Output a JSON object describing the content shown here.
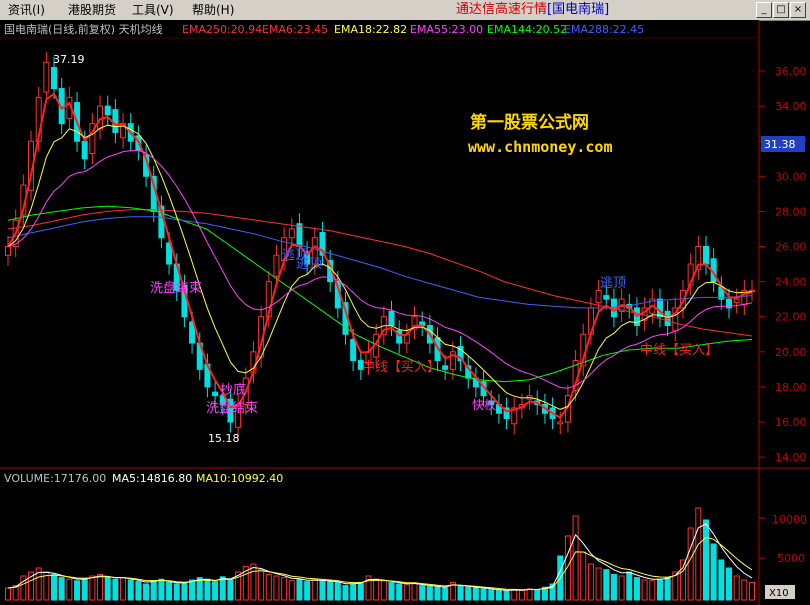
{
  "menu": {
    "items": [
      "资讯(I)",
      "港股期货",
      "工具(V)",
      "帮助(H)"
    ]
  },
  "window": {
    "title": "通达信高速行情",
    "stock": "[国电南瑞]",
    "buttons": [
      "_",
      "□",
      "×"
    ]
  },
  "header": {
    "caption": "国电南瑞(日线,前复权) 天机均线",
    "indicators": [
      {
        "text": "EMA250:20.94",
        "color": "#ff3030"
      },
      {
        "text": "EMA6:23.45",
        "color": "#ff3030"
      },
      {
        "text": "EMA18:22.82",
        "color": "#ffff40"
      },
      {
        "text": "EMA55:23.00",
        "color": "#ff40ff"
      },
      {
        "text": "EMA144:20.52",
        "color": "#00ff00"
      },
      {
        "text": "EMA288:22.45",
        "color": "#4060ff"
      }
    ]
  },
  "watermark": {
    "line1": "第一股票公式网",
    "line2": "www.chnmoney.com"
  },
  "price_axis": {
    "ticks": [
      "36.00",
      "34.00",
      "32.00",
      "30.00",
      "28.00",
      "26.00",
      "24.00",
      "22.00",
      "20.00",
      "18.00",
      "16.00",
      "14.00"
    ],
    "current": "31.38"
  },
  "annotations": {
    "high": "37.19",
    "low": "15.18",
    "wash1": "洗盘结束",
    "wash2": "洗盘结束",
    "bottom": "抄底",
    "top1": "逃顶",
    "top2": "逃顶",
    "top3": "逃顶",
    "mid_buy1": "中线【买入】",
    "mid_buy2": "中线【买入】",
    "fast": "快枚"
  },
  "volume": {
    "label": "VOLUME:17176.00",
    "ma5": "MA5:14816.80",
    "ma10": "MA10:10992.40",
    "ticks": [
      "10000",
      "5000"
    ],
    "unit": "X10"
  },
  "chart_data": {
    "type": "line",
    "note_series": "candlestick daily prices, approximate closes",
    "ylim": [
      13.2,
      37.2
    ],
    "close": [
      26.0,
      27.5,
      29.5,
      32.0,
      34.5,
      36.5,
      35.0,
      33.0,
      34.5,
      32.0,
      31.0,
      33.0,
      34.0,
      33.5,
      32.5,
      33.0,
      32.0,
      31.5,
      30.0,
      28.0,
      26.5,
      25.0,
      23.5,
      22.0,
      20.5,
      19.0,
      18.0,
      17.5,
      17.0,
      16.0,
      17.0,
      18.5,
      20.0,
      22.0,
      24.0,
      25.5,
      26.5,
      27.0,
      26.0,
      25.0,
      26.5,
      25.5,
      24.0,
      22.5,
      21.0,
      19.5,
      19.0,
      20.0,
      21.0,
      22.0,
      21.5,
      20.5,
      21.0,
      22.0,
      21.5,
      20.5,
      19.5,
      19.0,
      20.0,
      19.5,
      18.5,
      18.0,
      17.5,
      17.0,
      16.5,
      16.2,
      16.8,
      17.0,
      17.5,
      17.0,
      16.5,
      16.2,
      16.0,
      17.5,
      19.5,
      21.0,
      22.5,
      23.5,
      23.0,
      22.0,
      23.0,
      22.5,
      21.5,
      22.5,
      23.0,
      22.0,
      21.5,
      22.5,
      23.5,
      25.0,
      26.0,
      25.0,
      24.0,
      23.0,
      22.5,
      23.0,
      23.5,
      23.5
    ],
    "volume": [
      1500,
      1800,
      3000,
      3500,
      4000,
      3500,
      3200,
      2800,
      2600,
      2400,
      2600,
      3000,
      3200,
      2900,
      2600,
      2800,
      2500,
      2300,
      2000,
      2400,
      2600,
      2200,
      2000,
      2100,
      2500,
      2800,
      2600,
      2300,
      2900,
      2600,
      3500,
      4200,
      4500,
      3800,
      3200,
      3000,
      2800,
      2400,
      2600,
      2300,
      2500,
      2400,
      2300,
      2200,
      1800,
      2000,
      2200,
      3000,
      2600,
      2400,
      2200,
      2000,
      1900,
      2100,
      1800,
      1700,
      1600,
      1500,
      2200,
      1800,
      1600,
      1500,
      1400,
      1300,
      1200,
      1100,
      1300,
      1200,
      1400,
      1300,
      1600,
      2000,
      5500,
      8000,
      10500,
      6000,
      4500,
      4000,
      3800,
      3200,
      3000,
      3500,
      2800,
      2500,
      2400,
      2600,
      2800,
      3500,
      5000,
      9000,
      11500,
      10000,
      7000,
      5000,
      4000,
      3000,
      2500,
      2200
    ],
    "ma": [
      {
        "name": "EMA250",
        "color": "#ff3030",
        "values": [
          27.0,
          27.2,
          27.5,
          27.8,
          28.0,
          28.1,
          28.1,
          28.0,
          27.9,
          27.7,
          27.5,
          27.3,
          27.1,
          26.9,
          26.6,
          26.3,
          26.0,
          25.6,
          25.1,
          24.6,
          24.0,
          23.6,
          23.2,
          22.9,
          22.6,
          22.3,
          22.0,
          21.6,
          21.3,
          21.1,
          20.9
        ]
      },
      {
        "name": "EMA144",
        "color": "#00ff00",
        "values": [
          27.5,
          27.8,
          28.0,
          28.2,
          28.3,
          28.2,
          28.0,
          27.5,
          27.0,
          26.0,
          25.0,
          24.0,
          23.0,
          22.0,
          21.0,
          20.3,
          19.7,
          19.1,
          18.7,
          18.4,
          18.3,
          18.4,
          18.8,
          19.3,
          19.8,
          20.1,
          20.2,
          20.2,
          20.4,
          20.6,
          20.7
        ]
      },
      {
        "name": "EMA288",
        "color": "#4060ff",
        "values": [
          26.5,
          26.8,
          27.1,
          27.4,
          27.6,
          27.7,
          27.7,
          27.5,
          27.3,
          27.0,
          26.7,
          26.3,
          26.0,
          25.6,
          25.2,
          24.8,
          24.3,
          23.9,
          23.5,
          23.1,
          22.9,
          22.7,
          22.6,
          22.5,
          22.5,
          22.6,
          22.9,
          23.0,
          23.1,
          23.1,
          23.2
        ]
      }
    ]
  }
}
